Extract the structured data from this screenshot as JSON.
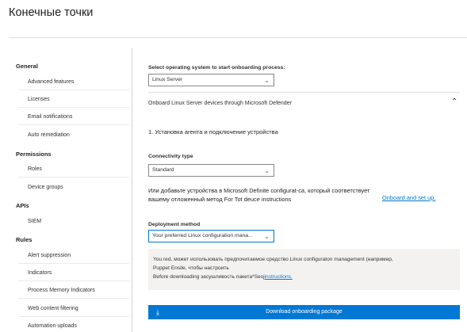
{
  "page": {
    "title": "Конечные точки"
  },
  "sidebar": {
    "groups": [
      {
        "label": "General"
      },
      {
        "label": "Permissions"
      },
      {
        "label": "APIs"
      },
      {
        "label": "Rules"
      }
    ],
    "items": [
      {
        "label": "Advanced features"
      },
      {
        "label": "Licenses"
      },
      {
        "label": "Email notifications"
      },
      {
        "label": "Auto remediation"
      },
      {
        "label": "Roles"
      },
      {
        "label": "Device groups"
      },
      {
        "label": "SIEM"
      },
      {
        "label": "Alert suppression"
      },
      {
        "label": "Indicators"
      },
      {
        "label": "Process Memory Indicators"
      },
      {
        "label": "Web content filtering"
      },
      {
        "label": "Automation uploads"
      }
    ]
  },
  "main": {
    "os_label": "Select operating system to start onboarding process:",
    "os_value": "Linux Server",
    "section_title": "Onboard Linux Server devices through Microsoft Defender",
    "step1": "1. Установка агента и подключение устройства",
    "connectivity_label": "Connectivity type",
    "connectivity_value": "Standard",
    "or_text_line1": "Или добавьте устройства в Microsoft Definite configurat-ca, который соответствует",
    "or_text_line2": "вашему отложенный метод For Tot deuce instructions",
    "onboard_link": "Onboard and set up.",
    "deployment_label": "Deployment method",
    "deployment_value": "Your preferred Linux configuration mana...",
    "info_line1": "You red, может использовать предпочитаемое средство Linux configuraton management (например,",
    "info_line2": "Puppet Ensile, чтобы настроить",
    "info_line3_prefix": "Before downloading засушливость пакета*Sesj",
    "info_link": "instructions.",
    "download_label": "Download onboarding package"
  },
  "icons": {
    "chevron": "chevron-down-icon",
    "collapse": "chevron-up-icon",
    "download": "download-icon"
  }
}
